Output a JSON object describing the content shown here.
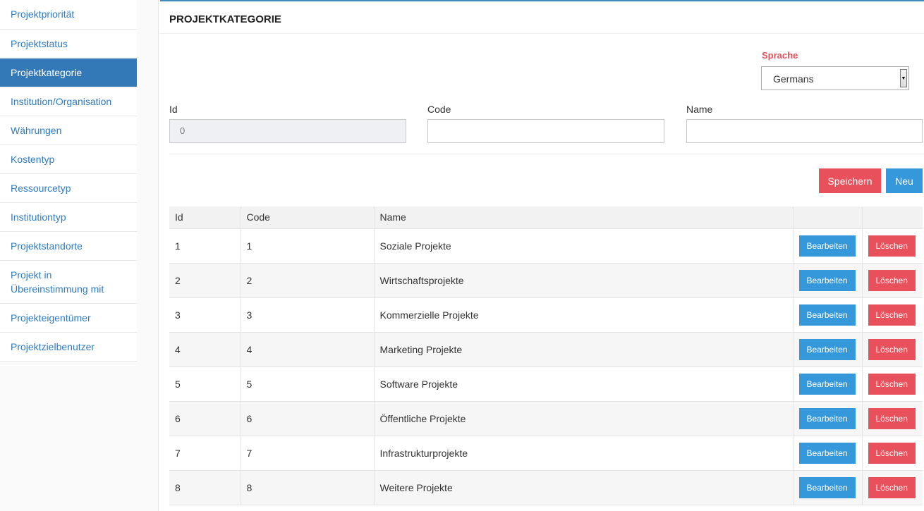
{
  "sidebar": {
    "items": [
      {
        "label": "Projektpriorität"
      },
      {
        "label": "Projektstatus"
      },
      {
        "label": "Projektkategorie"
      },
      {
        "label": "Institution/Organisation"
      },
      {
        "label": "Währungen"
      },
      {
        "label": "Kostentyp"
      },
      {
        "label": "Ressourcetyp"
      },
      {
        "label": "Institutiontyp"
      },
      {
        "label": "Projektstandorte"
      },
      {
        "label": "Projekt in Übereinstimmung mit"
      },
      {
        "label": "Projekteigentümer"
      },
      {
        "label": "Projektzielbenutzer"
      }
    ]
  },
  "page": {
    "title": "PROJEKTKATEGORIE"
  },
  "language": {
    "label": "Sprache",
    "selected": "Germans"
  },
  "form": {
    "id_label": "Id",
    "id_value": "0",
    "code_label": "Code",
    "code_value": "",
    "name_label": "Name",
    "name_value": ""
  },
  "actions": {
    "save_label": "Speichern",
    "new_label": "Neu"
  },
  "table": {
    "headers": {
      "id": "Id",
      "code": "Code",
      "name": "Name"
    },
    "rows": [
      {
        "id": "1",
        "code": "1",
        "name": "Soziale Projekte",
        "edit": "Bearbeiten",
        "delete": "Löschen"
      },
      {
        "id": "2",
        "code": "2",
        "name": "Wirtschaftsprojekte",
        "edit": "Bearbeiten",
        "delete": "Löschen"
      },
      {
        "id": "3",
        "code": "3",
        "name": "Kommerzielle Projekte",
        "edit": "Bearbeiten",
        "delete": "Löschen"
      },
      {
        "id": "4",
        "code": "4",
        "name": "Marketing Projekte",
        "edit": "Bearbeiten",
        "delete": "Löschen"
      },
      {
        "id": "5",
        "code": "5",
        "name": "Software Projekte",
        "edit": "Bearbeiten",
        "delete": "Löschen"
      },
      {
        "id": "6",
        "code": "6",
        "name": "Öffentliche Projekte",
        "edit": "Bearbeiten",
        "delete": "Löschen"
      },
      {
        "id": "7",
        "code": "7",
        "name": "Infrastrukturprojekte",
        "edit": "Bearbeiten",
        "delete": "Löschen"
      },
      {
        "id": "8",
        "code": "8",
        "name": "Weitere Projekte",
        "edit": "Bearbeiten",
        "delete": "Löschen"
      }
    ]
  }
}
